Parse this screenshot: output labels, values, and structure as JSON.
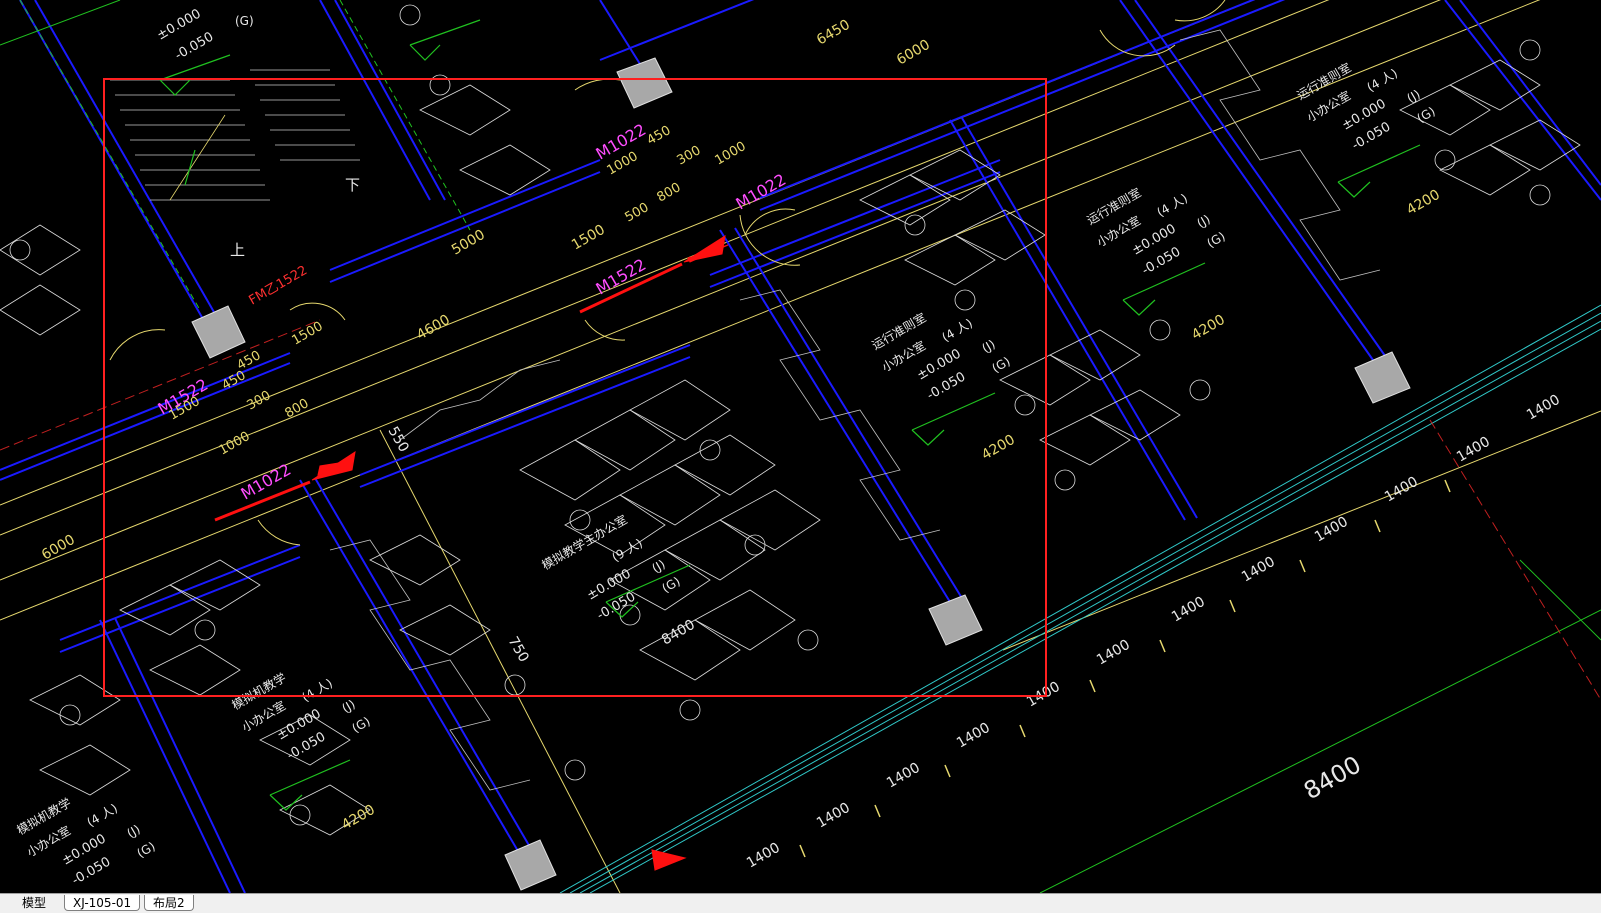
{
  "tabs": [
    {
      "label": "模型",
      "active": true
    },
    {
      "label": "XJ-105-01",
      "active": false
    },
    {
      "label": "布局2",
      "active": false
    }
  ],
  "colors": {
    "background": "#000000",
    "wall": "#1a1aff",
    "dimension": "#e6d86e",
    "door_tag": "#ff4dff",
    "furniture": "#dcdcdc",
    "column_fill": "#a8a8a8",
    "selection": "#ff2020",
    "green_line": "#20c020",
    "cyan_line": "#30c8c8"
  },
  "labels": {
    "door_tags": [
      "M1022",
      "M1522",
      "M1022",
      "M1022",
      "M1522"
    ],
    "fire_door": "FM乙1522",
    "stair_up": "上",
    "stair_down": "下",
    "dims_main": [
      "6450",
      "6000",
      "5000",
      "1500",
      "4600",
      "6000",
      "4200",
      "4200",
      "4200",
      "4200",
      "8400",
      "750",
      "550",
      "8400"
    ],
    "dims_small": [
      "450",
      "1000",
      "300",
      "1000",
      "500",
      "800",
      "450",
      "1500",
      "450",
      "1500",
      "300",
      "800",
      "1000"
    ],
    "axis_1400": [
      "1400",
      "1400",
      "1400",
      "1400",
      "1400",
      "1400",
      "1400",
      "1400",
      "1400",
      "1400",
      "1400",
      "1400",
      "1400",
      "1400"
    ],
    "rooms": [
      {
        "name": "模拟教学主办公室",
        "people": "(9 人)",
        "level1": "±0.000",
        "level1_tag": "(J)",
        "level2": "-0.050",
        "level2_tag": "(G)"
      },
      {
        "name": "运行准则室",
        "sub": "小办公室",
        "people": "(4 人)",
        "level1": "±0.000",
        "level1_tag": "(J)",
        "level2": "-0.050",
        "level2_tag": "(G)"
      },
      {
        "name": "运行准则室",
        "sub": "小办公室",
        "people": "(4 人)",
        "level1": "±0.000",
        "level1_tag": "(J)",
        "level2": "-0.050",
        "level2_tag": "(G)"
      },
      {
        "name": "运行准则室",
        "sub": "小办公室",
        "people": "(4 人)",
        "level1": "±0.000",
        "level1_tag": "(J)",
        "level2": "-0.050",
        "level2_tag": "(G)"
      },
      {
        "name": "模拟机教学",
        "sub": "小办公室",
        "people": "(4 人)",
        "level1": "±0.000",
        "level1_tag": "(J)",
        "level2": "-0.050",
        "level2_tag": "(G)"
      },
      {
        "name": "模拟机教学",
        "sub": "小办公室",
        "people": "(4 人)",
        "level1": "±0.000",
        "level1_tag": "(J)",
        "level2": "-0.050",
        "level2_tag": "(G)"
      }
    ],
    "top_levels": {
      "level1": "±0.000",
      "level1_tag": "(G)",
      "level2": "-0.050"
    }
  }
}
